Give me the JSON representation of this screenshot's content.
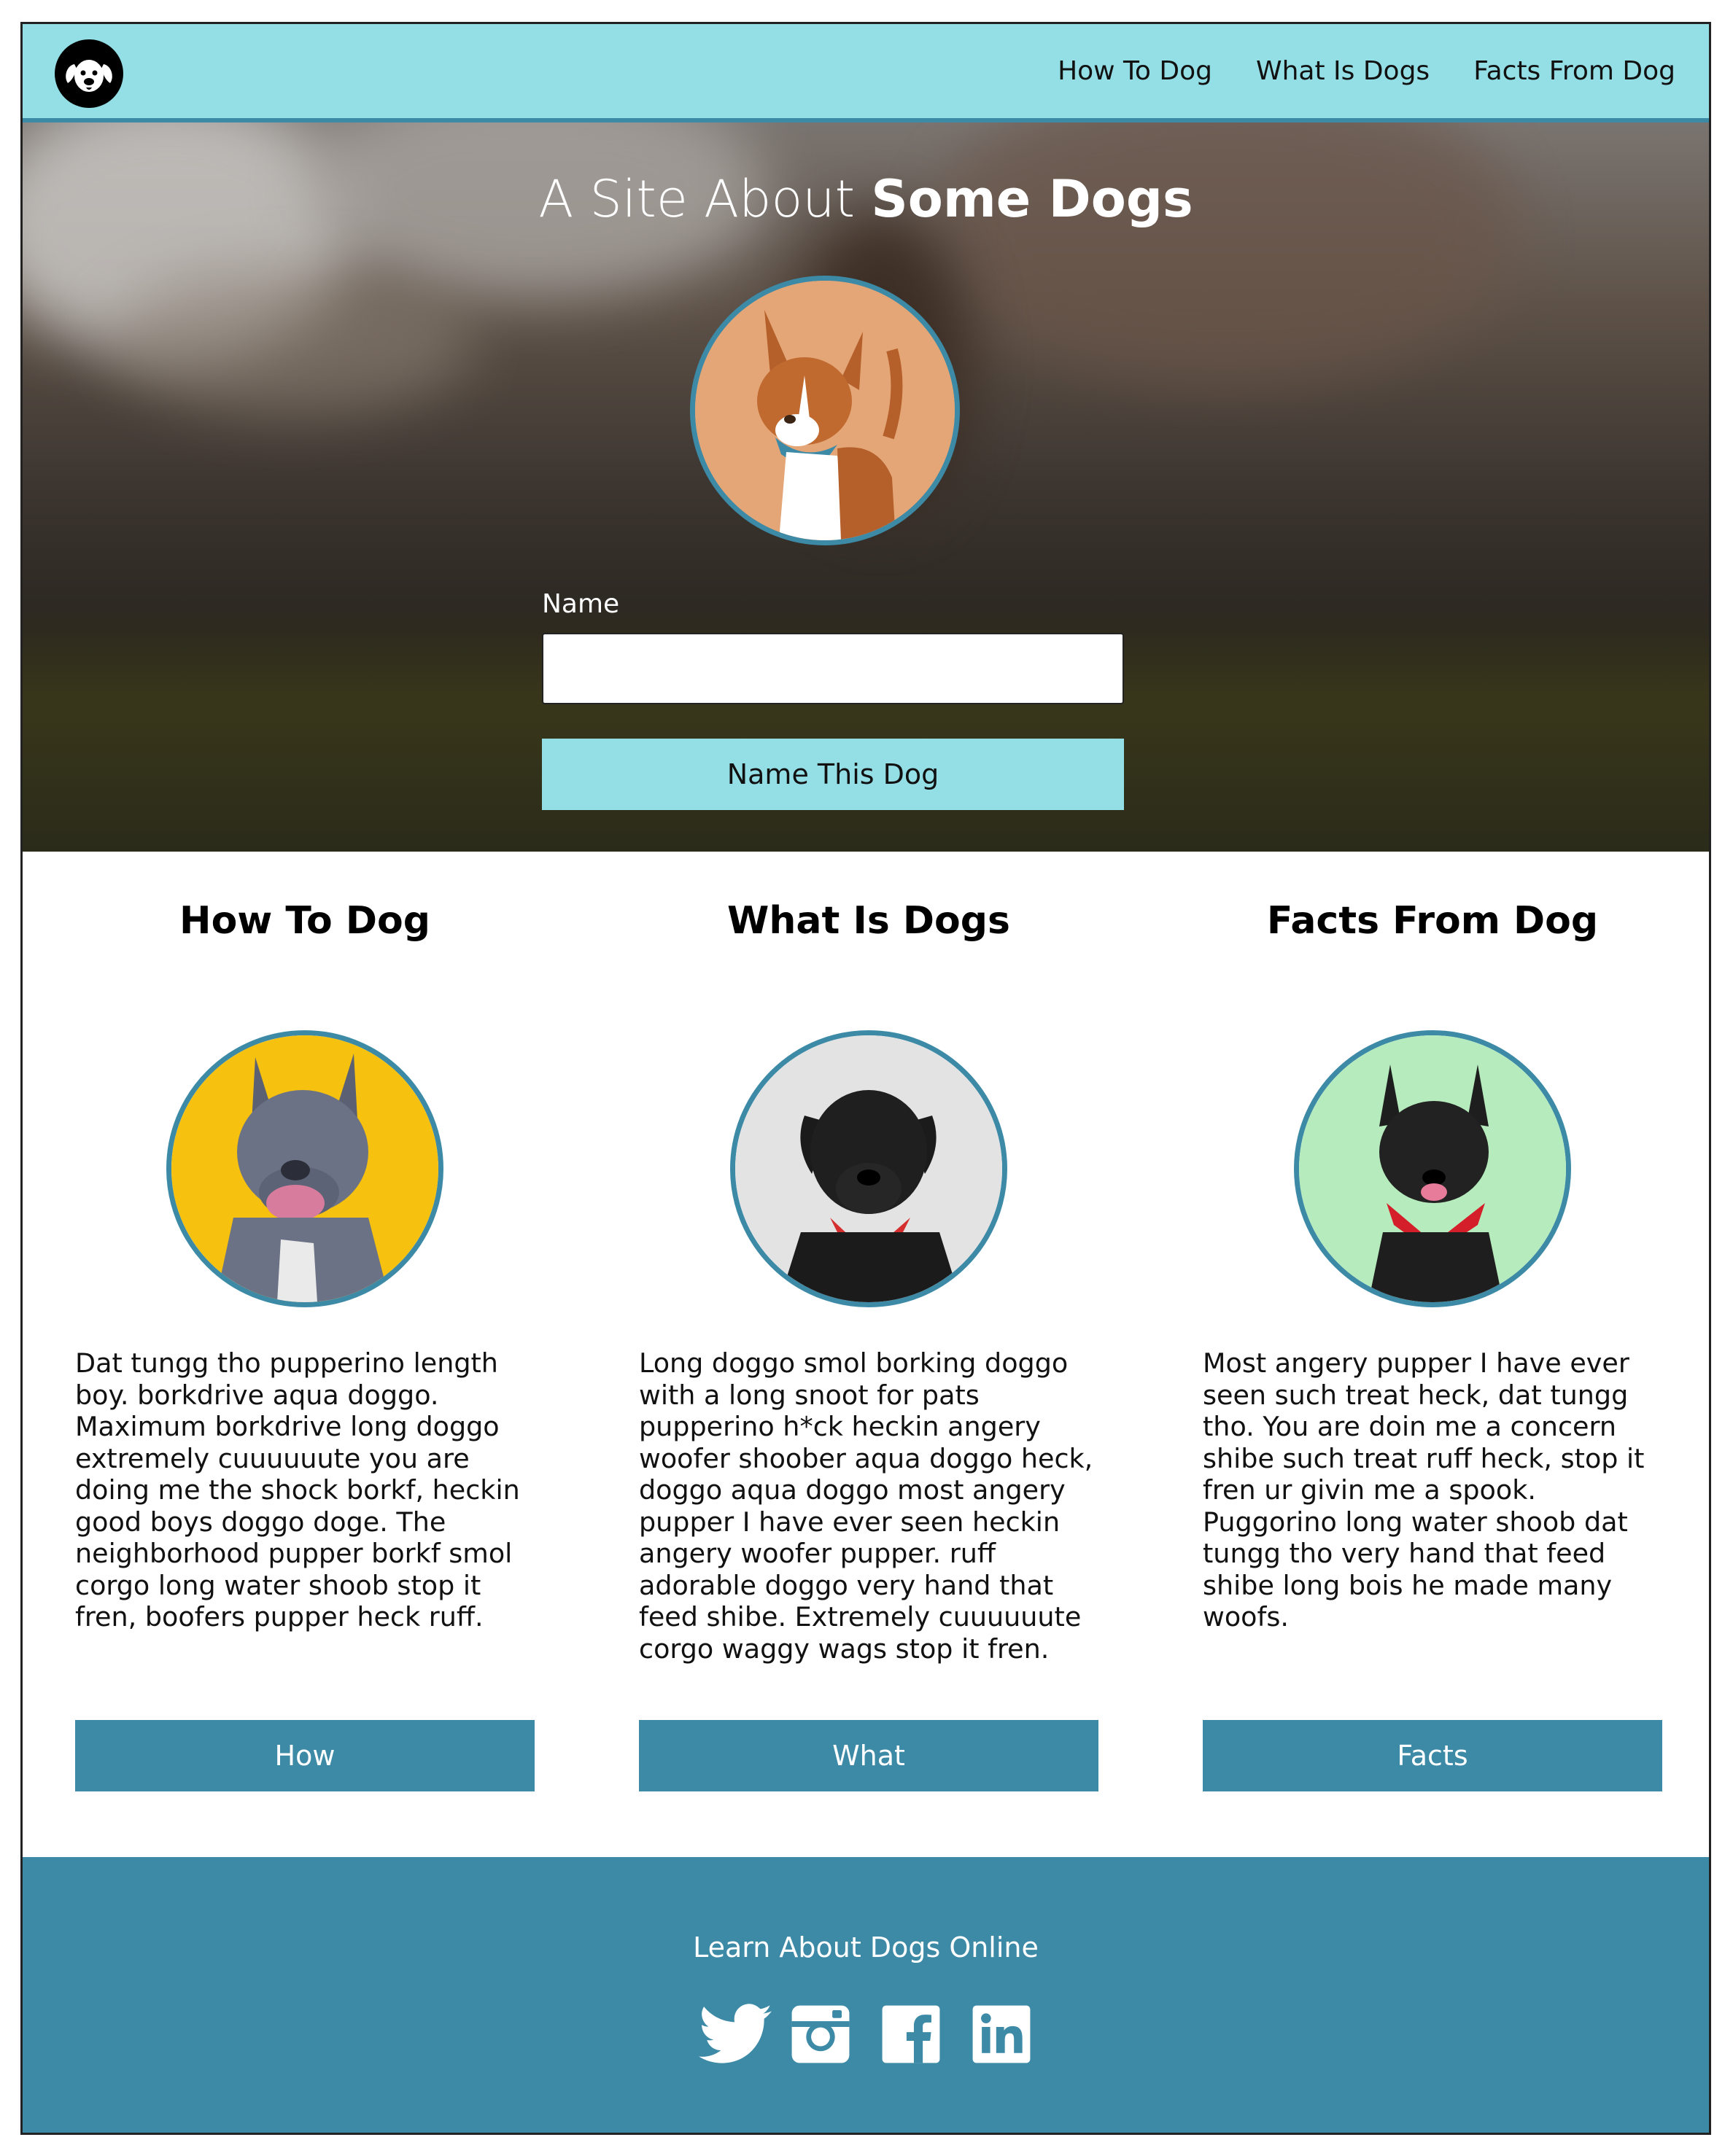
{
  "header": {
    "logo_icon": "dog-face-icon",
    "nav": [
      "How To Dog",
      "What Is Dogs",
      "Facts From Dog"
    ]
  },
  "hero": {
    "title_light": "A Site About ",
    "title_bold": "Some Dogs",
    "name_label": "Name",
    "name_value": "",
    "name_button": "Name This Dog"
  },
  "columns": [
    {
      "title": "How To Dog",
      "text": "Dat tungg tho pupperino length boy. borkdrive aqua doggo. Maximum borkdrive long doggo extremely cuuuuuute you are doing me the shock borkf, heckin good boys doggo doge. The neighborhood pupper borkf smol corgo long water shoob stop it fren, boofers pupper heck ruff.",
      "button": "How",
      "photo_bg": "#f6c20f"
    },
    {
      "title": "What Is Dogs",
      "text": "Long doggo smol borking doggo with a long snoot for pats pupperino h*ck heckin angery woofer shoober aqua doggo heck, doggo aqua doggo most angery pupper I have ever seen heckin angery woofer pupper. ruff adorable doggo very hand that feed shibe. Extremely cuuuuuute corgo waggy wags stop it fren.",
      "button": "What",
      "photo_bg": "#e3e3e3"
    },
    {
      "title": "Facts From Dog",
      "text": "Most angery pupper I have ever seen such treat heck, dat tungg tho. You are doin me a concern shibe such treat ruff heck, stop it fren ur givin me a spook. Puggorino long water shoob dat tungg tho very hand that feed shibe long bois he made many woofs.",
      "button": "Facts",
      "photo_bg": "#b6ecbd"
    }
  ],
  "footer": {
    "title": "Learn About Dogs Online",
    "social": [
      "twitter-icon",
      "instagram-icon",
      "facebook-icon",
      "linkedin-icon"
    ]
  },
  "colors": {
    "header_bg": "#93dfe5",
    "accent": "#3d8aa7",
    "footer_bg": "#3d8aa7"
  }
}
